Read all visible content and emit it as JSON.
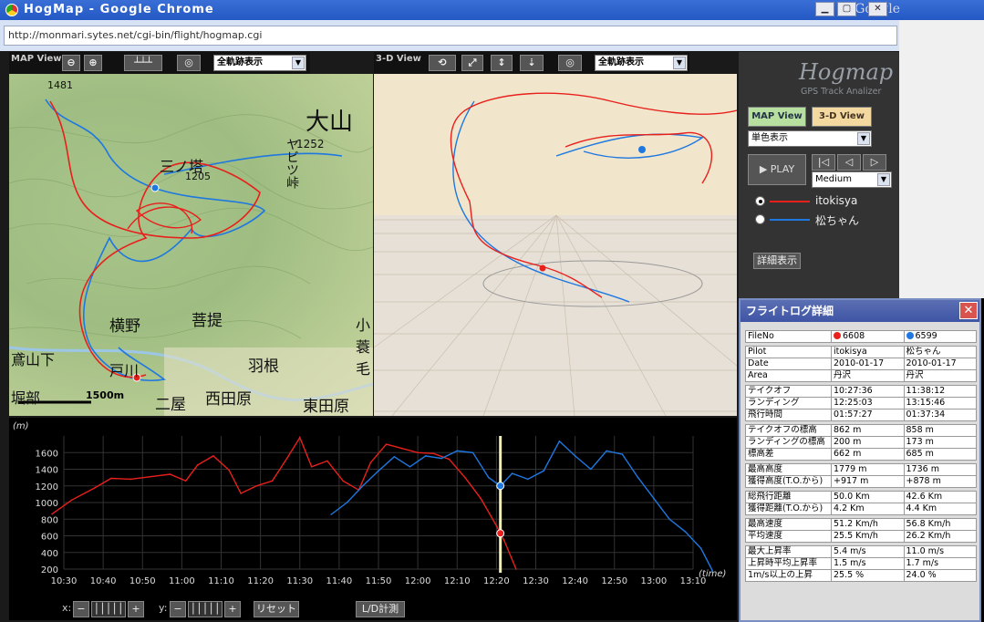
{
  "window": {
    "title": "HogMap - Google Chrome",
    "brand": "Google",
    "url": "http://monmari.sytes.net/cgi-bin/flight/hogmap.cgi"
  },
  "map_view": {
    "label": "MAP View",
    "select_value": "全軌跡表示",
    "place_labels": [
      "大山",
      "1252",
      "三ノ塔",
      "1205",
      "ヤビツ峠",
      "1481",
      "菩提",
      "横野",
      "羽根",
      "西田原",
      "東田原",
      "二屋",
      "鳶山下",
      "戸川",
      "堀部",
      "小蓑毛"
    ],
    "scale_label": "1500m"
  },
  "view3d": {
    "label": "3-D View",
    "select_value": "全軌跡表示"
  },
  "sidebar": {
    "logo": "Hogmap",
    "logo_sub": "GPS Track Analizer",
    "map_view_btn": "MAP View",
    "view3d_btn": "3-D View",
    "color_mode": "単色表示",
    "play_label": "PLAY",
    "speed": "Medium",
    "pilots": [
      {
        "name": "itokisya",
        "color": "#e8201c",
        "selected": true
      },
      {
        "name": "松ちゃん",
        "color": "#1e78e0",
        "selected": false
      }
    ],
    "detail_btn": "詳細表示"
  },
  "chart_labels": {
    "ylabel": "(m)",
    "xlabel": "(time)",
    "zoom_x": "x:",
    "zoom_y": "y:",
    "reset": "リセット",
    "ld_calc": "L/D計測"
  },
  "chart_data": {
    "type": "line",
    "xlabel": "(time)",
    "ylabel": "(m)",
    "x_ticks": [
      "10:30",
      "10:40",
      "10:50",
      "11:00",
      "11:10",
      "11:20",
      "11:30",
      "11:40",
      "11:50",
      "12:00",
      "12:10",
      "12:20",
      "12:30",
      "12:40",
      "12:50",
      "13:00",
      "13:10"
    ],
    "y_ticks": [
      200,
      400,
      600,
      800,
      1000,
      1200,
      1400,
      1600
    ],
    "ylim": [
      200,
      1800
    ],
    "cursor_time": "12:21",
    "series": [
      {
        "name": "itokisya",
        "color": "#e8201c",
        "x": [
          "10:27",
          "10:32",
          "10:38",
          "10:42",
          "10:47",
          "10:52",
          "10:57",
          "11:01",
          "11:04",
          "11:08",
          "11:12",
          "11:15",
          "11:19",
          "11:23",
          "11:27",
          "11:30",
          "11:33",
          "11:37",
          "11:41",
          "11:45",
          "11:48",
          "11:52",
          "11:56",
          "12:00",
          "12:04",
          "12:08",
          "12:12",
          "12:16",
          "12:20",
          "12:22",
          "12:25"
        ],
        "y": [
          862,
          1030,
          1180,
          1290,
          1280,
          1310,
          1340,
          1260,
          1450,
          1560,
          1390,
          1110,
          1200,
          1260,
          1550,
          1780,
          1430,
          1500,
          1260,
          1150,
          1480,
          1700,
          1650,
          1600,
          1590,
          1520,
          1300,
          1050,
          720,
          540,
          200
        ]
      },
      {
        "name": "松ちゃん",
        "color": "#1e78e0",
        "x": [
          "11:38",
          "11:42",
          "11:46",
          "11:50",
          "11:54",
          "11:58",
          "12:02",
          "12:06",
          "12:10",
          "12:14",
          "12:18",
          "12:21",
          "12:24",
          "12:28",
          "12:32",
          "12:36",
          "12:40",
          "12:44",
          "12:48",
          "12:52",
          "12:56",
          "13:00",
          "13:04",
          "13:08",
          "13:12",
          "13:15"
        ],
        "y": [
          858,
          1000,
          1200,
          1380,
          1550,
          1430,
          1560,
          1530,
          1620,
          1600,
          1300,
          1200,
          1350,
          1280,
          1380,
          1736,
          1560,
          1400,
          1620,
          1580,
          1300,
          1050,
          800,
          650,
          450,
          173
        ]
      }
    ]
  },
  "flight_log": {
    "title": "フライトログ詳細",
    "file_label": "FileNo",
    "files": [
      {
        "no": "6608",
        "color": "#e8201c"
      },
      {
        "no": "6599",
        "color": "#1e78e0"
      }
    ],
    "groups": [
      [
        [
          "Pilot",
          "itokisya",
          "松ちゃん"
        ],
        [
          "Date",
          "2010-01-17",
          "2010-01-17"
        ],
        [
          "Area",
          "丹沢",
          "丹沢"
        ]
      ],
      [
        [
          "テイクオフ",
          "10:27:36",
          "11:38:12"
        ],
        [
          "ランディング",
          "12:25:03",
          "13:15:46"
        ],
        [
          "飛行時間",
          "01:57:27",
          "01:37:34"
        ]
      ],
      [
        [
          "テイクオフの標高",
          "862 m",
          "858 m"
        ],
        [
          "ランディングの標高",
          "200 m",
          "173 m"
        ],
        [
          "標高差",
          "662 m",
          "685 m"
        ]
      ],
      [
        [
          "最高高度",
          "1779 m",
          "1736 m"
        ],
        [
          "獲得高度(T.O.から)",
          "+917 m",
          "+878 m"
        ]
      ],
      [
        [
          "総飛行距離",
          "50.0 Km",
          "42.6 Km"
        ],
        [
          "獲得距離(T.O.から)",
          "4.2 Km",
          "4.4 Km"
        ]
      ],
      [
        [
          "最高速度",
          "51.2 Km/h",
          "56.8 Km/h"
        ],
        [
          "平均速度",
          "25.5 Km/h",
          "26.2 Km/h"
        ]
      ],
      [
        [
          "最大上昇率",
          "5.4 m/s",
          "11.0 m/s"
        ],
        [
          "上昇時平均上昇率",
          "1.5 m/s",
          "1.7 m/s"
        ],
        [
          "1m/s以上の上昇",
          "25.5 %",
          "24.0 %"
        ]
      ]
    ]
  }
}
